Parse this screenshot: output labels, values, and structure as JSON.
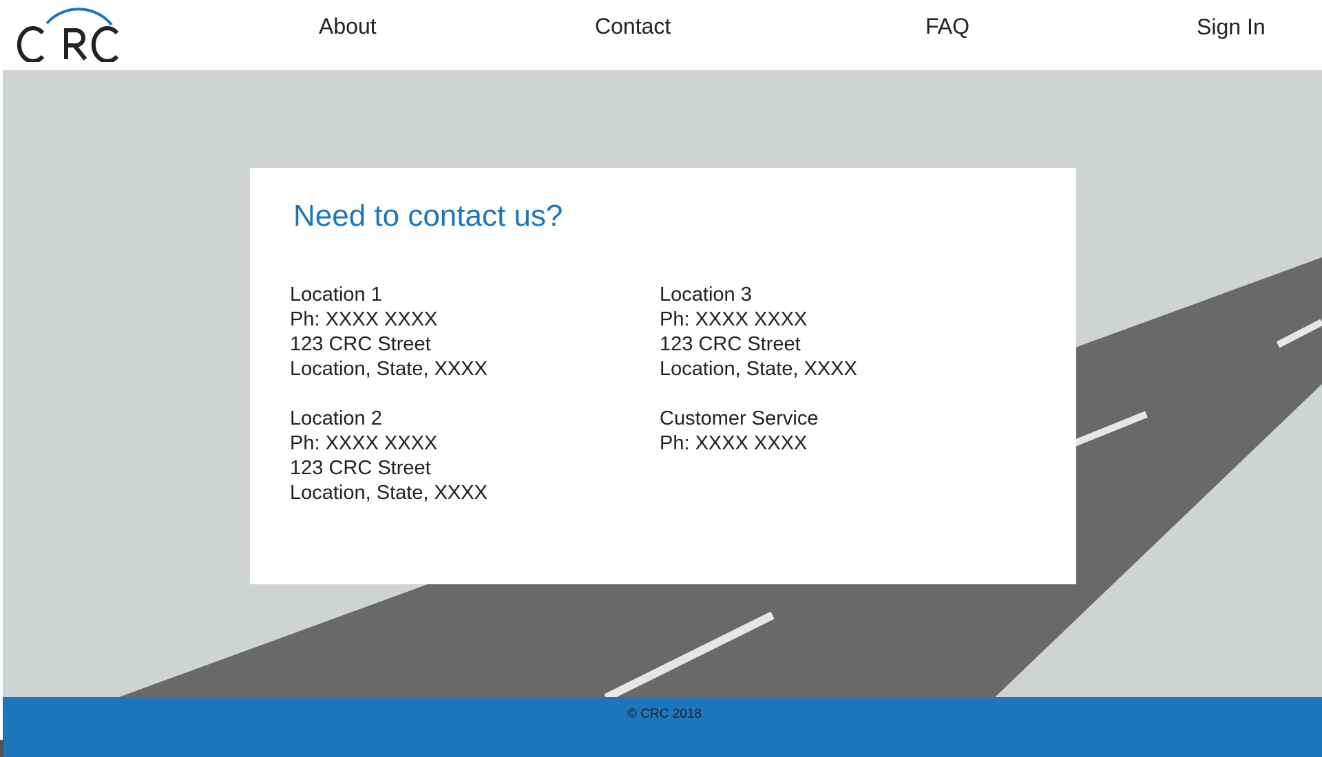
{
  "brand": {
    "logo_text": "CRC",
    "accent_color": "#1d76bb"
  },
  "nav": {
    "about": "About",
    "contact": "Contact",
    "faq": "FAQ",
    "sign_in": "Sign In"
  },
  "contact_card": {
    "title": "Need to contact us?",
    "locations": [
      {
        "name": "Location 1",
        "phone": "Ph: XXXX XXXX",
        "street": "123 CRC Street",
        "city": "Location, State, XXXX"
      },
      {
        "name": "Location 2",
        "phone": "Ph: XXXX XXXX",
        "street": "123 CRC Street",
        "city": "Location, State, XXXX"
      },
      {
        "name": "Location 3",
        "phone": "Ph: XXXX XXXX",
        "street": "123 CRC Street",
        "city": "Location, State, XXXX"
      }
    ],
    "customer_service": {
      "name": "Customer Service",
      "phone": "Ph: XXXX XXXX"
    }
  },
  "footer": {
    "copyright": "© CRC 2018"
  },
  "colors": {
    "hero_background": "#d0d3d4",
    "road": "#696969",
    "lane_marking": "#e6e6e6",
    "footer_background": "#1d76bb"
  }
}
